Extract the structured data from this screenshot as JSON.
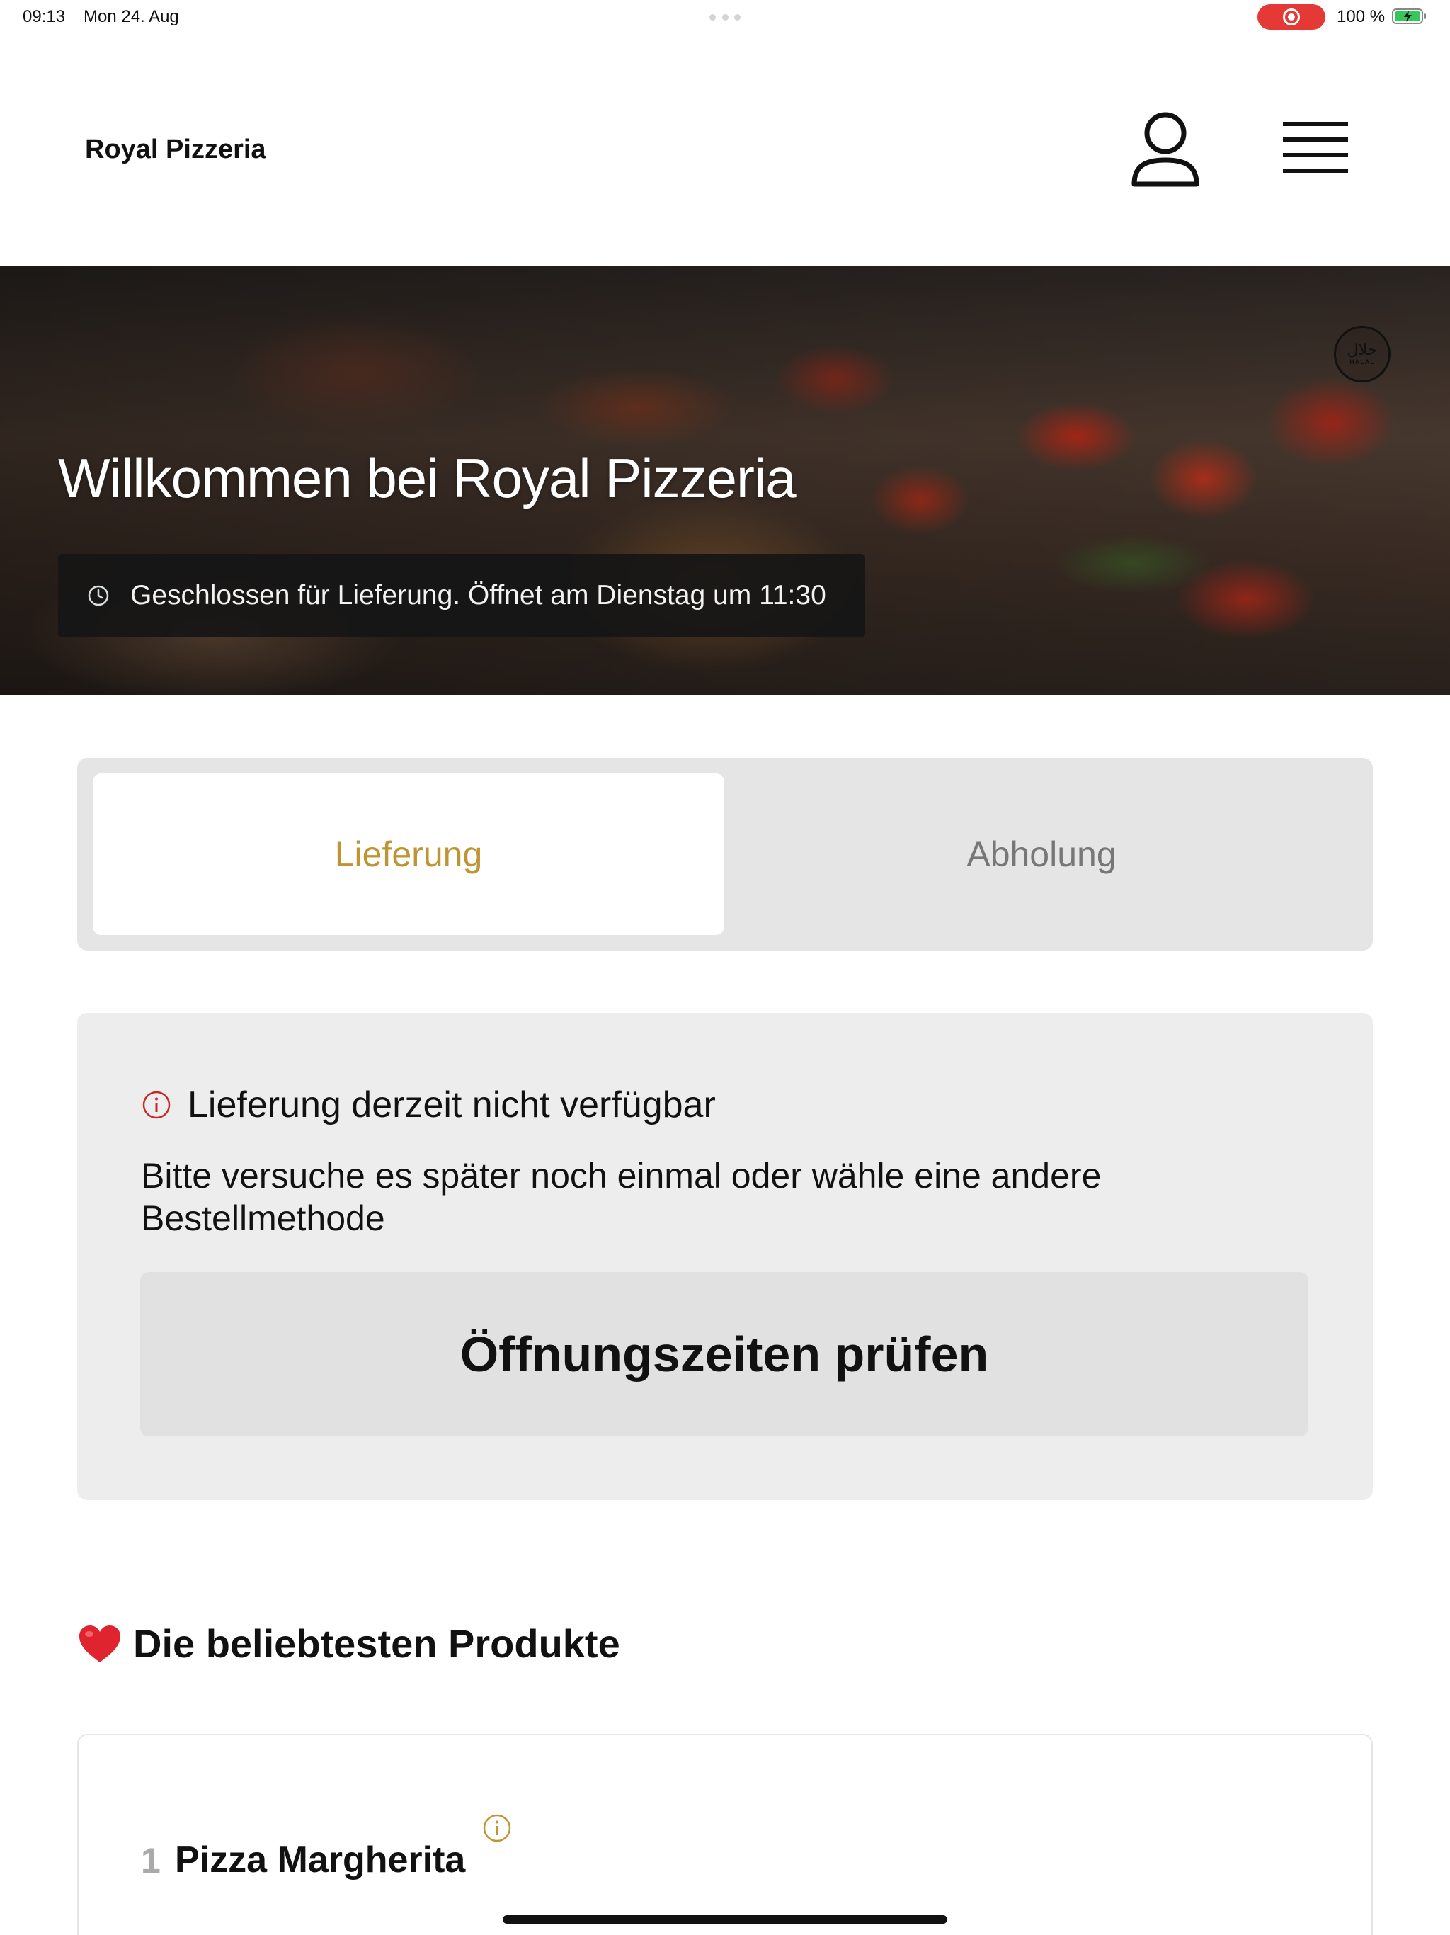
{
  "status_bar": {
    "time": "09:13",
    "date": "Mon 24. Aug",
    "battery": "100 %",
    "recording_indicator_color": "#e53935",
    "icons": [
      "record-icon",
      "battery-charging-icon"
    ]
  },
  "header": {
    "brand": "Royal Pizzeria",
    "icons": [
      "user-icon",
      "hamburger-menu-icon"
    ]
  },
  "hero": {
    "title": "Willkommen bei Royal Pizzeria",
    "status_text": "Geschlossen für Lieferung. Öffnet am Dienstag um 11:30",
    "halal_badge_arabic": "حلال",
    "halal_badge_latin": "HALAL"
  },
  "order_mode": {
    "options": [
      {
        "label": "Lieferung",
        "selected": true
      },
      {
        "label": "Abholung",
        "selected": false
      }
    ],
    "accent_color": "#bf9434"
  },
  "notice": {
    "title": "Lieferung derzeit nicht verfügbar",
    "body": "Bitte versuche es später noch einmal oder wähle eine andere Bestellmethode",
    "button_label": "Öffnungszeiten prüfen",
    "icon_color": "#c62828"
  },
  "popular": {
    "title": "Die beliebtesten Produkte",
    "products": [
      {
        "rank": "1",
        "name": "Pizza Margherita"
      }
    ]
  }
}
